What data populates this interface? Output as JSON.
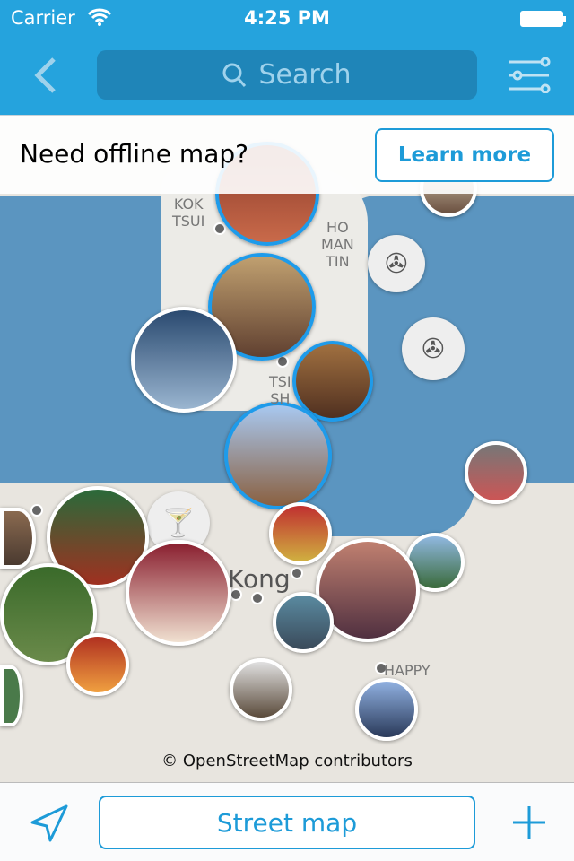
{
  "status": {
    "carrier": "Carrier",
    "time": "4:25 PM"
  },
  "nav": {
    "search_placeholder": "Search",
    "back_icon": "chevron-left-icon",
    "filter_icon": "sliders-icon"
  },
  "banner": {
    "text": "Need offline map?",
    "button": "Learn more"
  },
  "map": {
    "labels": [
      "KOK\nTSUI",
      "HO\nMAN\nTIN",
      "TSI\nSH",
      "Kong",
      "HAPPY"
    ],
    "credit": "© OpenStreetMap contributors",
    "category_icons": [
      "film-reel-icon",
      "film-reel-icon",
      "cocktail-icon"
    ]
  },
  "footer": {
    "street_map": "Street map",
    "locate_icon": "location-arrow-icon",
    "add_icon": "plus-icon"
  },
  "colors": {
    "accent": "#25a3dd",
    "water": "#5b95c0",
    "land": "#e8e5df",
    "selected_ring": "#1e9bea"
  }
}
